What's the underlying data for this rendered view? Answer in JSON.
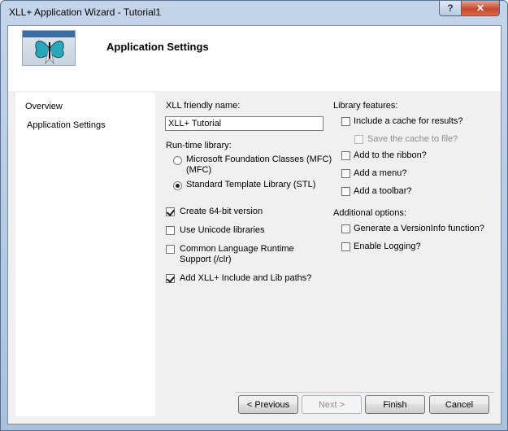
{
  "window": {
    "title": "XLL+ Application Wizard - Tutorial1",
    "help_label": "?",
    "close_label": "✕"
  },
  "header": {
    "title": "Application Settings",
    "image": "butterfly-banner-image"
  },
  "nav": {
    "items": [
      {
        "label": "Overview"
      },
      {
        "label": "Application Settings"
      }
    ]
  },
  "settings": {
    "friendly_name_label": "XLL friendly name:",
    "friendly_name_value": "XLL+ Tutorial",
    "runtime_label": "Run-time library:",
    "runtime_options": [
      {
        "label": "Microsoft Foundation Classes (MFC)",
        "selected": false
      },
      {
        "label": "Standard Template Library (STL)",
        "selected": true
      }
    ],
    "options": [
      {
        "label": "Create 64-bit version",
        "checked": true
      },
      {
        "label": "Use Unicode libraries",
        "checked": false
      },
      {
        "label": "Common Language Runtime Support (/clr)",
        "checked": false
      },
      {
        "label": "Add XLL+ Include and Lib paths?",
        "checked": true
      }
    ],
    "library_label": "Library features:",
    "library_features": [
      {
        "label": "Include a cache for results?",
        "checked": false
      },
      {
        "label": "Save the cache to file?",
        "checked": false,
        "disabled": true
      },
      {
        "label": "Add to the ribbon?",
        "checked": false
      },
      {
        "label": "Add a menu?",
        "checked": false
      },
      {
        "label": "Add a toolbar?",
        "checked": false
      }
    ],
    "additional_label": "Additional options:",
    "additional_options": [
      {
        "label": "Generate a VersionInfo function?",
        "checked": false
      },
      {
        "label": "Enable Logging?",
        "checked": false
      }
    ]
  },
  "footer": {
    "previous": "< Previous",
    "next": "Next >",
    "finish": "Finish",
    "cancel": "Cancel"
  }
}
